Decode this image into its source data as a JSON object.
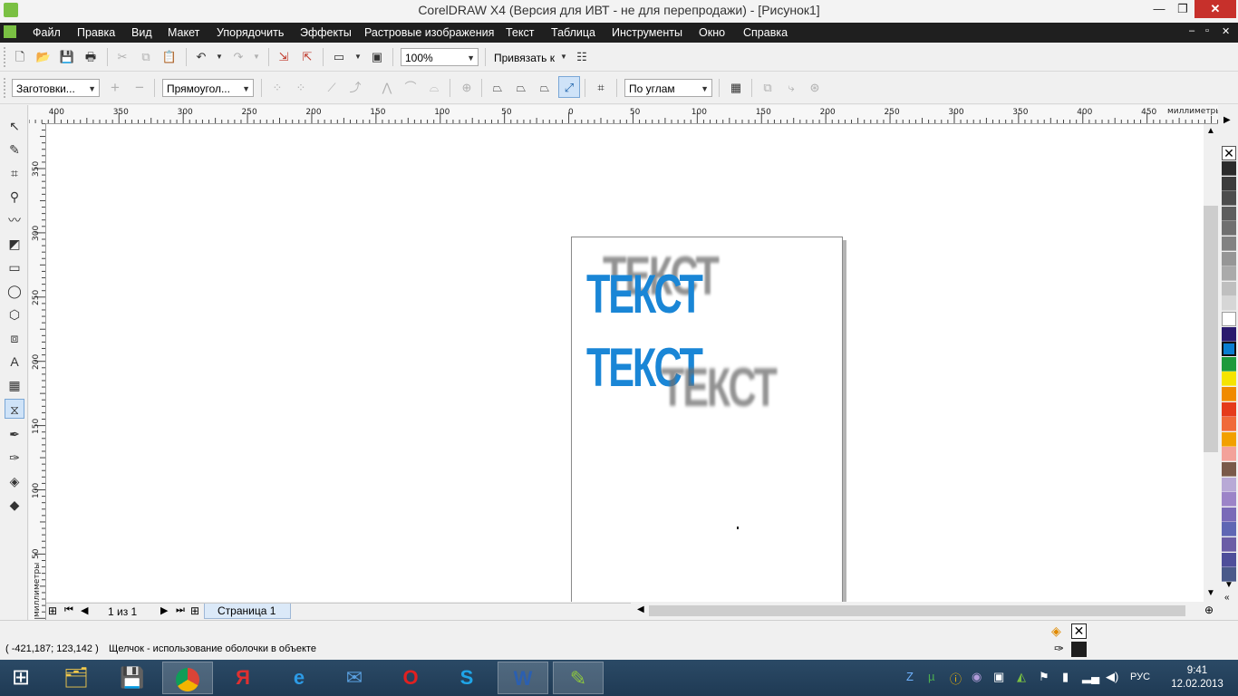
{
  "window": {
    "title": "CorelDRAW X4 (Версия для ИВТ - не для перепродажи) - [Рисунок1]",
    "minimize": "—",
    "maximize": "❐",
    "close": "✕"
  },
  "menubar": {
    "items": [
      "Файл",
      "Правка",
      "Вид",
      "Макет",
      "Упорядочить",
      "Эффекты",
      "Растровые изображения",
      "Текст",
      "Таблица",
      "Инструменты",
      "Окно",
      "Справка"
    ],
    "doc_minimize": "–",
    "doc_restore": "▫",
    "doc_close": "✕"
  },
  "toolbar1": {
    "zoom_value": "100%",
    "snap_label": "Привязать к"
  },
  "toolbar2": {
    "presets_value": "Заготовки...",
    "shape_value": "Прямоугол...",
    "mapping_value": "По углам"
  },
  "rulers": {
    "unit": "миллиметры",
    "h_ticks": [
      "400",
      "350",
      "300",
      "250",
      "200",
      "150",
      "100",
      "50",
      "0",
      "50",
      "100",
      "150",
      "200",
      "250",
      "300",
      "350",
      "400",
      "450"
    ],
    "v_ticks": [
      "350",
      "300",
      "250",
      "200",
      "150",
      "100",
      "50"
    ]
  },
  "canvas": {
    "text_top_blue": "ТЕКСТ",
    "text_top_shadow": "ТЕКСТ",
    "text_bottom_blue": "ТЕКСТ",
    "text_bottom_shadow": "ТЕКСТ",
    "text_color": "#1a86d6",
    "shadow_color": "#6e6e6e"
  },
  "pagenav": {
    "page_count": "1 из 1",
    "page_tab": "Страница 1"
  },
  "palette": {
    "colors": [
      "#2b2b2b",
      "#3c3c3c",
      "#4d4d4d",
      "#5e5e5e",
      "#707070",
      "#828282",
      "#969696",
      "#aaaaaa",
      "#bfbfbf",
      "#d6d6d6",
      "#ffffff",
      "#2a1a6e",
      "#0a7ed0",
      "#1d9a3c",
      "#f5e400",
      "#f08a00",
      "#e53b1b",
      "#f06a3a",
      "#f2a000",
      "#f3a29a",
      "#7a5a4a",
      "#b8a9d6",
      "#9c84c8",
      "#7a6ab8",
      "#5f66b4",
      "#6b5da6",
      "#4e4e9a",
      "#4a5a8a"
    ]
  },
  "statusbar": {
    "coords": "( -421,187; 123,142 )",
    "message": "Щелчок - использование оболочки в объекте"
  },
  "taskbar": {
    "clock_time": "9:41",
    "clock_date": "12.02.2013",
    "lang": "РУС"
  }
}
